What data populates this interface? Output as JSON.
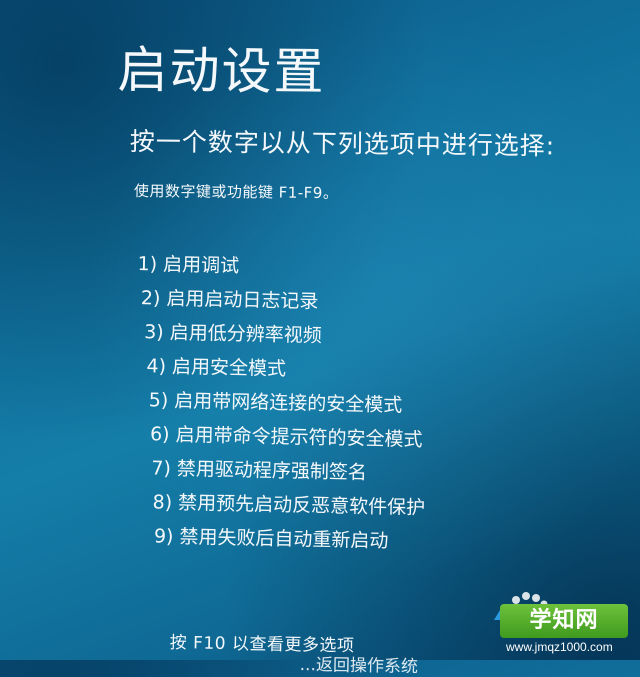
{
  "screen": {
    "title": "启动设置",
    "subtitle": "按一个数字以从下列选项中进行选择:",
    "hint": "使用数字键或功能键 F1-F9。"
  },
  "options": [
    {
      "num": "1)",
      "label": "启用调试"
    },
    {
      "num": "2)",
      "label": "启用启动日志记录"
    },
    {
      "num": "3)",
      "label": "启用低分辨率视频"
    },
    {
      "num": "4)",
      "label": "启用安全模式"
    },
    {
      "num": "5)",
      "label": "启用带网络连接的安全模式"
    },
    {
      "num": "6)",
      "label": "启用带命令提示符的安全模式"
    },
    {
      "num": "7)",
      "label": "禁用驱动程序强制签名"
    },
    {
      "num": "8)",
      "label": "禁用预先启动反恶意软件保护"
    },
    {
      "num": "9)",
      "label": "禁用失败后自动重新启动"
    }
  ],
  "footer": {
    "more_options": "按 F10 以查看更多选项",
    "partial_line": "...返回操作系统"
  },
  "watermark": {
    "brand": "学知网",
    "site": "www.jmqz1000.com"
  },
  "colors": {
    "background": "#11739f",
    "text": "#f4f8fb",
    "watermark_green": "#4fae27"
  }
}
